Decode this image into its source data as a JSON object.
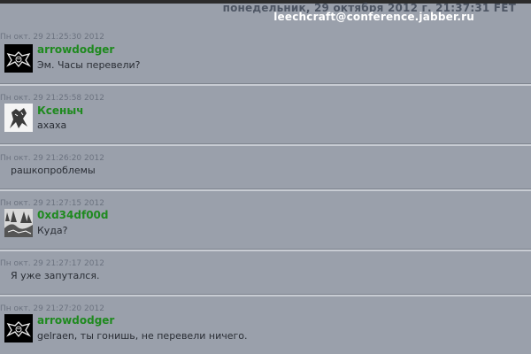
{
  "header": {
    "date": "понедельник, 29 октября 2012 г. 21:37:31 FET",
    "room": "leechcraft@conference.jabber.ru"
  },
  "messages": [
    {
      "timestamp": "Пн окт. 29 21:25:30 2012",
      "nick": "arrowdodger",
      "text": "Эм. Часы перевели?",
      "avatar": "bat-skull-icon"
    },
    {
      "timestamp": "Пн окт. 29 21:25:58 2012",
      "nick": "Ксеныч",
      "text": "ахаха",
      "avatar": "creature-sketch-icon"
    },
    {
      "timestamp": "Пн окт. 29 21:26:20 2012",
      "text": "рашкопроблемы"
    },
    {
      "timestamp": "Пн окт. 29 21:27:15 2012",
      "nick": "0xd34df00d",
      "text": "Куда?",
      "avatar": "forest-scene-icon"
    },
    {
      "timestamp": "Пн окт. 29 21:27:17 2012",
      "text": "Я уже запутался."
    },
    {
      "timestamp": "Пн окт. 29 21:27:20 2012",
      "nick": "arrowdodger",
      "text": "gelraen, ты гонишь, не перевели ничего.",
      "avatar": "bat-skull-icon"
    }
  ]
}
